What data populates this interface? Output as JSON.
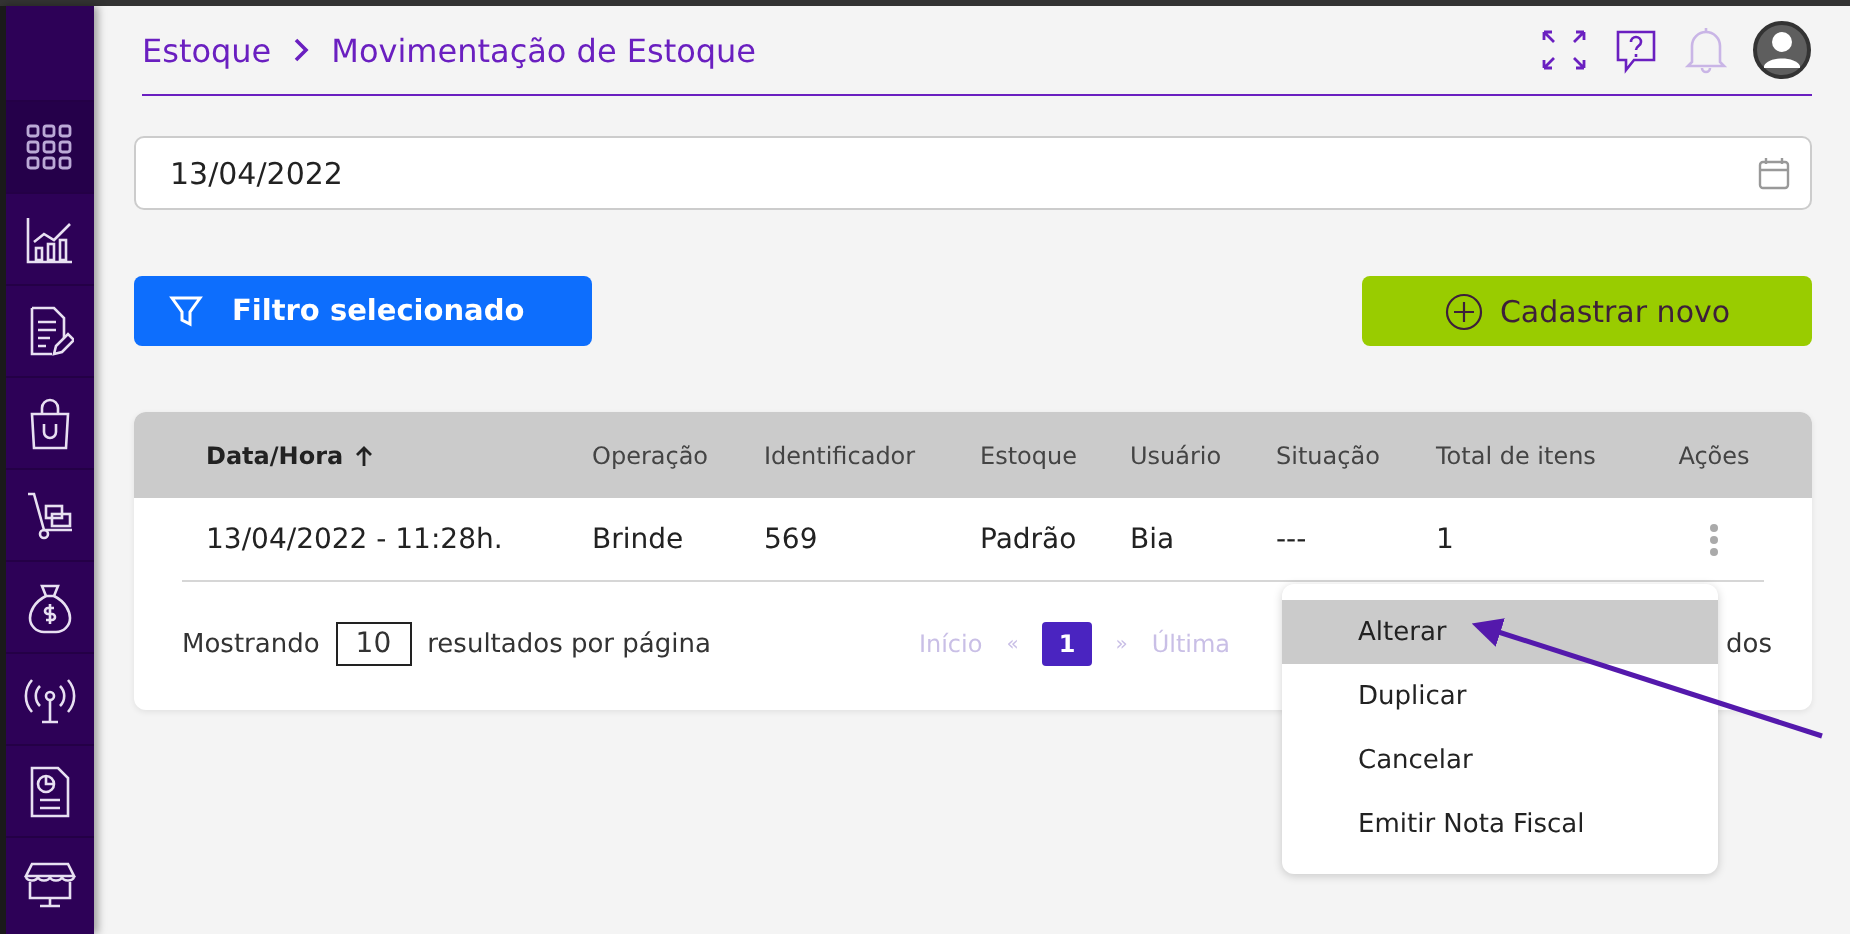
{
  "sidebar": {
    "items": [
      {
        "kind": "apps",
        "selected": true
      },
      {
        "kind": "chart",
        "selected": false
      },
      {
        "kind": "document",
        "selected": false
      },
      {
        "kind": "bag",
        "selected": false
      },
      {
        "kind": "cart",
        "selected": false
      },
      {
        "kind": "money",
        "selected": false
      },
      {
        "kind": "antenna",
        "selected": false
      },
      {
        "kind": "report",
        "selected": false
      },
      {
        "kind": "store",
        "selected": false
      }
    ]
  },
  "breadcrumb": [
    {
      "label": "Estoque"
    },
    {
      "label": "Movimentação de Estoque"
    }
  ],
  "date_field": {
    "value": "13/04/2022"
  },
  "filter_button": {
    "label": "Filtro selecionado"
  },
  "new_button": {
    "label": "Cadastrar novo"
  },
  "table": {
    "columns": [
      {
        "label": "Data/Hora",
        "sorted": true
      },
      {
        "label": "Operação",
        "sorted": false
      },
      {
        "label": "Identificador",
        "sorted": false
      },
      {
        "label": "Estoque",
        "sorted": false
      },
      {
        "label": "Usuário",
        "sorted": false
      },
      {
        "label": "Situação",
        "sorted": false
      },
      {
        "label": "Total de itens",
        "sorted": false
      },
      {
        "label": "Ações",
        "sorted": false
      }
    ],
    "rows": [
      {
        "cells": [
          "13/04/2022 - 11:28h.",
          "Brinde",
          "569",
          "Padrão",
          "Bia",
          "---",
          "1"
        ]
      }
    ]
  },
  "pagination": {
    "prefix": "Mostrando",
    "page_size": "10",
    "suffix": "resultados por página",
    "first": "Início",
    "prev": "«",
    "pages": [
      {
        "label": "1",
        "selected": true
      }
    ],
    "next": "»",
    "last": "Última",
    "results_text": "dos"
  },
  "action_menu": {
    "items": [
      {
        "label": "Alterar",
        "selected": true
      },
      {
        "label": "Duplicar",
        "selected": false
      },
      {
        "label": "Cancelar",
        "selected": false
      },
      {
        "label": "Emitir Nota Fiscal",
        "selected": false
      }
    ]
  }
}
